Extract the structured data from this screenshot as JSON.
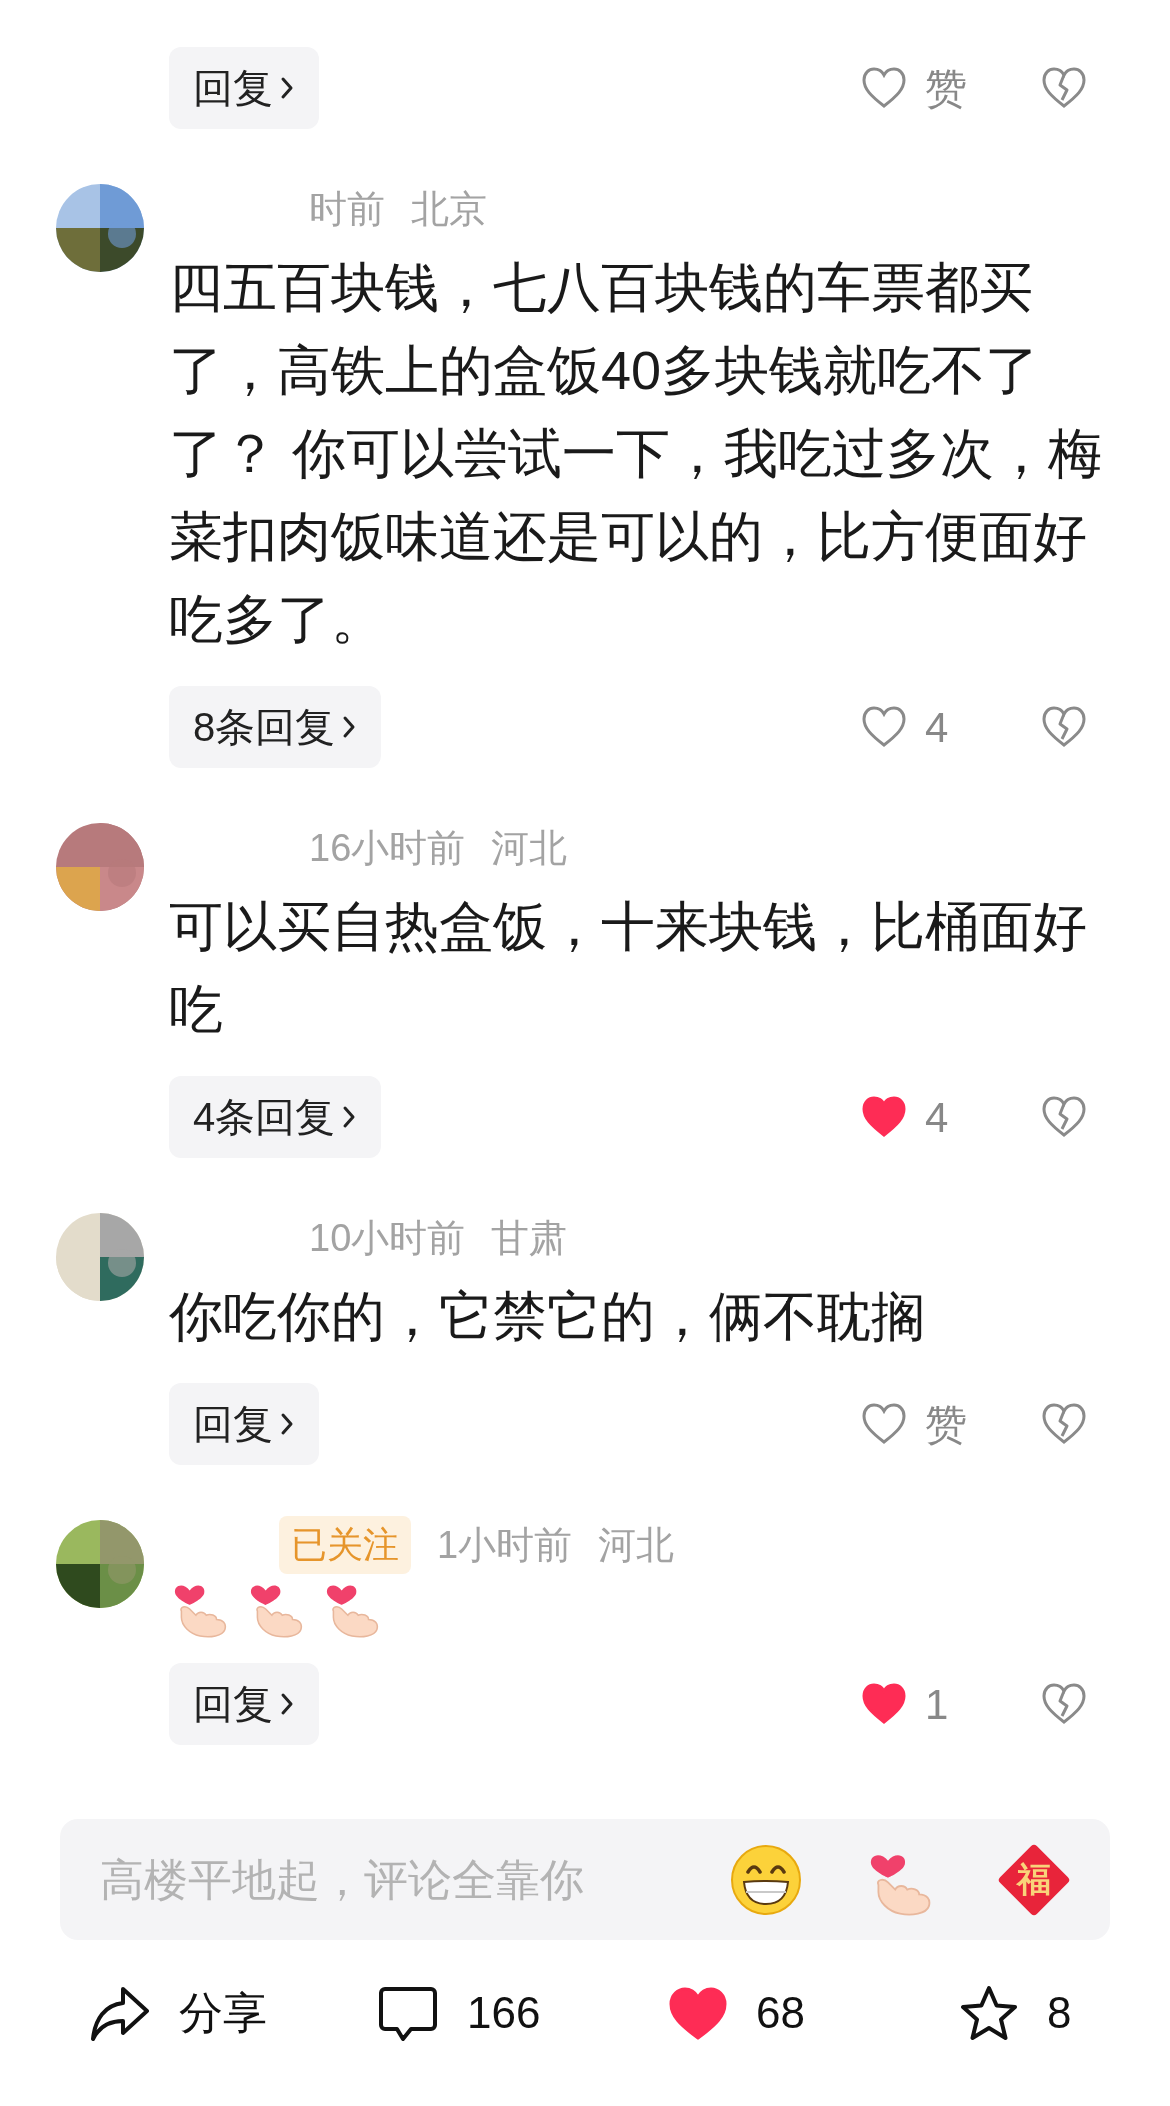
{
  "comments": [
    {
      "reply_label": "回复",
      "like_label": "赞",
      "liked": false
    },
    {
      "time": "时前",
      "region": "北京",
      "text": "四五百块钱，七八百块钱的车票都买了，高铁上的盒饭40多块钱就吃不了了？ 你可以尝试一下，我吃过多次，梅菜扣肉饭味道还是可以的，比方便面好吃多了。",
      "reply_label": "8条回复",
      "like_label": "4",
      "liked": false
    },
    {
      "time": "16小时前",
      "region": "河北",
      "text": "可以买自热盒饭，十来块钱，比桶面好吃",
      "reply_label": "4条回复",
      "like_label": "4",
      "liked": true
    },
    {
      "time": "10小时前",
      "region": "甘肃",
      "text": "你吃你的，它禁它的，俩不耽搁",
      "reply_label": "回复",
      "like_label": "赞",
      "liked": false
    },
    {
      "tag": "已关注",
      "time": "1小时前",
      "region": "河北",
      "emojis": [
        {
          "kind": "finger_heart"
        },
        {
          "kind": "finger_heart"
        },
        {
          "kind": "finger_heart"
        }
      ],
      "reply_label": "回复",
      "like_label": "1",
      "liked": true
    }
  ],
  "comment_input": {
    "placeholder": "高楼平地起，评论全靠你",
    "quick_emojis": [
      {
        "kind": "grin"
      },
      {
        "kind": "finger_heart"
      },
      {
        "kind": "fu",
        "label": "福"
      }
    ]
  },
  "bottom_bar": {
    "share": "分享",
    "comments": "166",
    "likes": "68",
    "liked": true,
    "favorites": "8",
    "favorited": false
  }
}
